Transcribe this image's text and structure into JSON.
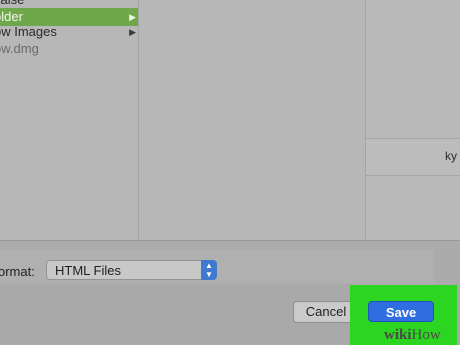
{
  "column1": {
    "items": [
      {
        "label": "kaise",
        "selected": false,
        "has_children": false,
        "dim": false
      },
      {
        "label": "older",
        "selected": true,
        "has_children": true,
        "dim": false
      },
      {
        "label": "ow Images",
        "selected": false,
        "has_children": true,
        "dim": false
      },
      {
        "label": "ow.dmg",
        "selected": false,
        "has_children": false,
        "dim": true
      }
    ]
  },
  "column3": {
    "partial_item": "ky"
  },
  "format": {
    "label": "ormat:",
    "selected_value": "HTML Files"
  },
  "buttons": {
    "cancel_label": "Cancel",
    "save_label": "Save"
  },
  "watermark": {
    "wiki": "wiki",
    "how": "How"
  },
  "colors": {
    "selection": "#6fa84a",
    "save_button": "#2f6ee0",
    "highlight": "#2cd51f"
  }
}
